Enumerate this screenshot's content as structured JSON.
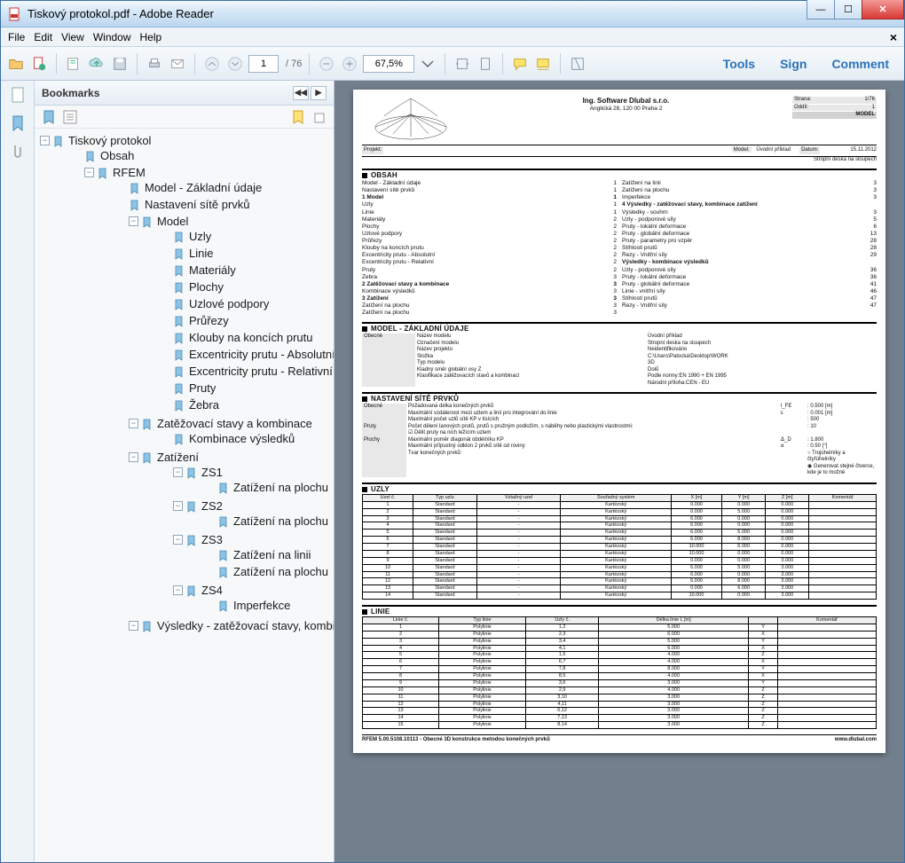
{
  "window": {
    "title": "Tiskový protokol.pdf - Adobe Reader"
  },
  "menu": {
    "file": "File",
    "edit": "Edit",
    "view": "View",
    "window": "Window",
    "help": "Help"
  },
  "toolbar": {
    "page_current": "1",
    "page_total": "/ 76",
    "zoom": "67,5%",
    "tools": "Tools",
    "sign": "Sign",
    "comment": "Comment"
  },
  "sidebar": {
    "title": "Bookmarks",
    "tree": [
      {
        "label": "Tiskový protokol",
        "open": true,
        "children": [
          {
            "label": "Obsah"
          },
          {
            "label": "RFEM",
            "open": true,
            "children": [
              {
                "label": "Model - Základní údaje"
              },
              {
                "label": "Nastavení sítě prvků"
              },
              {
                "label": "Model",
                "open": true,
                "children": [
                  {
                    "label": "Uzly"
                  },
                  {
                    "label": "Linie"
                  },
                  {
                    "label": "Materiály"
                  },
                  {
                    "label": "Plochy"
                  },
                  {
                    "label": "Uzlové podpory"
                  },
                  {
                    "label": "Průřezy"
                  },
                  {
                    "label": "Klouby na koncích prutu"
                  },
                  {
                    "label": "Excentricity prutu - Absolutní"
                  },
                  {
                    "label": "Excentricity prutu - Relativní"
                  },
                  {
                    "label": "Pruty"
                  },
                  {
                    "label": "Žebra"
                  }
                ]
              },
              {
                "label": "Zatěžovací stavy a kombinace",
                "open": true,
                "children": [
                  {
                    "label": "Kombinace výsledků"
                  }
                ]
              },
              {
                "label": "Zatížení",
                "open": true,
                "children": [
                  {
                    "label": "ZS1",
                    "open": true,
                    "children": [
                      {
                        "label": "Zatížení na plochu"
                      }
                    ]
                  },
                  {
                    "label": "ZS2",
                    "open": true,
                    "children": [
                      {
                        "label": "Zatížení na plochu"
                      }
                    ]
                  },
                  {
                    "label": "ZS3",
                    "open": true,
                    "children": [
                      {
                        "label": "Zatížení na linii"
                      },
                      {
                        "label": "Zatížení na plochu"
                      }
                    ]
                  },
                  {
                    "label": "ZS4",
                    "open": true,
                    "children": [
                      {
                        "label": "Imperfekce"
                      }
                    ]
                  }
                ]
              },
              {
                "label": "Výsledky - zatěžovací stavy, kombinace zatížení",
                "open": true,
                "children": []
              }
            ]
          }
        ]
      }
    ]
  },
  "doc": {
    "company": "Ing. Software Dlubal s.r.o.",
    "addr": "Anglická 28, 120 00 Praha 2",
    "strana_lbl": "Strana:",
    "strana": "1/76",
    "oddil_lbl": "Oddíl:",
    "oddil": "1",
    "badge": "MODEL",
    "projekt_lbl": "Projekt:",
    "model_lbl": "Model:",
    "model_val": "Úvodní příklad",
    "model_sub": "Stropní deska na sloupech",
    "datum_lbl": "Datum:",
    "datum": "15.11.2012",
    "sec_obsah": "OBSAH",
    "toc_left": [
      [
        "",
        "Model - Základní údaje",
        "1"
      ],
      [
        "",
        "Nastavení sítě prvků",
        "1"
      ],
      [
        "1",
        "Model",
        "1",
        true
      ],
      [
        "",
        "Uzly",
        "1"
      ],
      [
        "",
        "Linie",
        "1"
      ],
      [
        "",
        "Materiály",
        "2"
      ],
      [
        "",
        "Plochy",
        "2"
      ],
      [
        "",
        "Uzlové podpory",
        "2"
      ],
      [
        "",
        "Průřezy",
        "2"
      ],
      [
        "",
        "Klouby na koncích prutu",
        "2"
      ],
      [
        "",
        "Excentricity prutu - Absolutní",
        "2"
      ],
      [
        "",
        "Excentricity prutu - Relativní",
        "2"
      ],
      [
        "",
        "Pruty",
        "2"
      ],
      [
        "",
        "Žebra",
        "3"
      ],
      [
        "2",
        "Zatěžovací stavy a kombinace",
        "3",
        true
      ],
      [
        "",
        "Kombinace výsledků",
        "3"
      ],
      [
        "3",
        "Zatížení",
        "3",
        true
      ],
      [
        "",
        "Zatížení na plochu",
        "3"
      ],
      [
        "",
        "Zatížení na plochu",
        "3"
      ]
    ],
    "toc_right": [
      [
        "",
        "Zatížení na linii",
        "3"
      ],
      [
        "",
        "Zatížení na plochu",
        "3"
      ],
      [
        "",
        "Imperfekce",
        "3"
      ],
      [
        "4",
        "Výsledky - zatěžovací stavy, kombinace zatížení",
        "",
        true
      ],
      [
        "",
        "Výsledky - souhrn",
        "3"
      ],
      [
        "",
        "Uzly - podporové síly",
        "5"
      ],
      [
        "",
        "Pruty - lokální deformace",
        "6"
      ],
      [
        "",
        "Pruty - globální deformace",
        "13"
      ],
      [
        "",
        "Pruty - parametry pro vzpěr",
        "28"
      ],
      [
        "",
        "Štíhlosti prutů",
        "28"
      ],
      [
        "",
        "Řezy - Vnitřní síly",
        "29"
      ],
      [
        "",
        "Výsledky - kombinace výsledků",
        "",
        true
      ],
      [
        "",
        "Uzly - podporové síly",
        "36"
      ],
      [
        "",
        "Pruty - lokální deformace",
        "36"
      ],
      [
        "",
        "Pruty - globální deformace",
        "41"
      ],
      [
        "",
        "Linie - vnitřní síly",
        "46"
      ],
      [
        "",
        "Štíhlosti prutů",
        "47"
      ],
      [
        "",
        "Řezy - Vnitřní síly",
        "47"
      ]
    ],
    "sec_model": "MODEL - ZÁKLADNÍ ÚDAJE",
    "model_kv": [
      [
        "Obecné",
        "Název modelu",
        "Úvodní příklad"
      ],
      [
        "",
        "Označení modelu",
        "Stropní deska na sloupech"
      ],
      [
        "",
        "Název projektu",
        "Neidentifikováno"
      ],
      [
        "",
        "Složka",
        "C:\\Users\\Patocka\\Desktop\\WORK"
      ],
      [
        "",
        "Typ modelu",
        "3D"
      ],
      [
        "",
        "Kladný směr globální osy Z",
        "Dolů"
      ],
      [
        "",
        "Klasifikace zatěžovacích stavů a kombinací",
        "Podle normy:EN 1990 + EN 1995"
      ],
      [
        "",
        "",
        "Národní příloha:CEN - EU"
      ]
    ],
    "sec_nast": "NASTAVENÍ SÍTĚ PRVKŮ",
    "nast_lines": [
      [
        "Obecné",
        "Požadovaná délka konečných prvků",
        "l_FE",
        ": 0.500 [m]"
      ],
      [
        "",
        "Maximální vzdálenost mezi uzlem a linií pro integrování do linie",
        "ε",
        ": 0.001 [m]"
      ],
      [
        "",
        "Maximální počet uzlů sítě KP v tisících",
        "",
        ": 500"
      ],
      [
        "Pruty",
        "Počet dělení lanových prutů, prutů s pružným podložím, s náběhy nebo plastickými vlastnostmi:",
        "",
        ": 10"
      ],
      [
        "",
        "☑ Dělit pruty na nich ležícím uzlem",
        "",
        ""
      ],
      [
        "Plochy",
        "Maximální poměr diagonál obdélníku KP",
        "Δ_D",
        ": 1.800"
      ],
      [
        "",
        "Maximální přípustný odklon 2 prvků sítě od roviny",
        "α",
        ": 0.50 [°]"
      ],
      [
        "",
        "Tvar konečných prvků:",
        "",
        "○ Trojúhelníky a čtyřúhelníky"
      ],
      [
        "",
        "",
        "",
        "◉ Generovat stejné čtverce, kde je to možné"
      ]
    ],
    "sec_uzly": "UZLY",
    "uzly_head": [
      "Uzel č.",
      "Typ uzlu",
      "Vztažný uzel",
      "Souřadný systém",
      "X [m]",
      "Y [m]",
      "Z [m]",
      "Komentář"
    ],
    "uzly_rows": [
      [
        "1",
        "Standard",
        "-",
        "Kartézský",
        "0.000",
        "0.000",
        "0.000",
        ""
      ],
      [
        "2",
        "Standard",
        "-",
        "Kartézský",
        "0.000",
        "5.000",
        "0.000",
        ""
      ],
      [
        "3",
        "Standard",
        "-",
        "Kartézský",
        "6.000",
        "0.000",
        "0.000",
        ""
      ],
      [
        "4",
        "Standard",
        "-",
        "Kartézský",
        "6.000",
        "0.000",
        "0.000",
        ""
      ],
      [
        "5",
        "Standard",
        "-",
        "Kartézský",
        "6.000",
        "5.000",
        "0.000",
        ""
      ],
      [
        "6",
        "Standard",
        "-",
        "Kartézský",
        "6.000",
        "8.000",
        "0.000",
        ""
      ],
      [
        "7",
        "Standard",
        "-",
        "Kartézský",
        "10.000",
        "6.000",
        "0.000",
        ""
      ],
      [
        "8",
        "Standard",
        "-",
        "Kartézský",
        "10.000",
        "0.000",
        "0.000",
        ""
      ],
      [
        "9",
        "Standard",
        "-",
        "Kartézský",
        "0.000",
        "0.000",
        "3.000",
        ""
      ],
      [
        "10",
        "Standard",
        "-",
        "Kartézský",
        "6.000",
        "5.000",
        "3.000",
        ""
      ],
      [
        "11",
        "Standard",
        "-",
        "Kartézský",
        "6.000",
        "0.000",
        "3.000",
        ""
      ],
      [
        "12",
        "Standard",
        "-",
        "Kartézský",
        "6.000",
        "8.000",
        "3.000",
        ""
      ],
      [
        "13",
        "Standard",
        "-",
        "Kartézský",
        "0.000",
        "6.000",
        "3.000",
        ""
      ],
      [
        "14",
        "Standard",
        "-",
        "Kartézský",
        "10.000",
        "0.000",
        "3.000",
        ""
      ]
    ],
    "sec_linie": "LINIE",
    "linie_head": [
      "Linie č.",
      "Typ linie",
      "Uzly č.",
      "Délka linie L [m]",
      "",
      "Komentář"
    ],
    "linie_rows": [
      [
        "1",
        "Polylinie",
        "1,2",
        "5.000",
        "Y",
        ""
      ],
      [
        "2",
        "Polylinie",
        "2,3",
        "6.000",
        "X",
        ""
      ],
      [
        "3",
        "Polylinie",
        "3,4",
        "5.000",
        "Y",
        ""
      ],
      [
        "4",
        "Polylinie",
        "4,1",
        "6.000",
        "X",
        ""
      ],
      [
        "5",
        "Polylinie",
        "1,5",
        "4.000",
        "Z",
        ""
      ],
      [
        "6",
        "Polylinie",
        "6,7",
        "4.000",
        "X",
        ""
      ],
      [
        "7",
        "Polylinie",
        "7,8",
        "8.000",
        "Y",
        ""
      ],
      [
        "8",
        "Polylinie",
        "8,5",
        "4.000",
        "X",
        ""
      ],
      [
        "9",
        "Polylinie",
        "3,6",
        "3.000",
        "Y",
        ""
      ],
      [
        "10",
        "Polylinie",
        "2,9",
        "4.000",
        "Z",
        ""
      ],
      [
        "11",
        "Polylinie",
        "3,10",
        "3.000",
        "Z",
        ""
      ],
      [
        "12",
        "Polylinie",
        "4,11",
        "3.000",
        "Z",
        ""
      ],
      [
        "13",
        "Polylinie",
        "6,12",
        "3.000",
        "Z",
        ""
      ],
      [
        "14",
        "Polylinie",
        "7,13",
        "3.000",
        "Z",
        ""
      ],
      [
        "15",
        "Polylinie",
        "8,14",
        "3.000",
        "Z",
        ""
      ]
    ],
    "footer_left": "RFEM 5.00.5108.10113 - Obecné 3D konstrukce metodou konečných prvků",
    "footer_right": "www.dlubal.com"
  }
}
